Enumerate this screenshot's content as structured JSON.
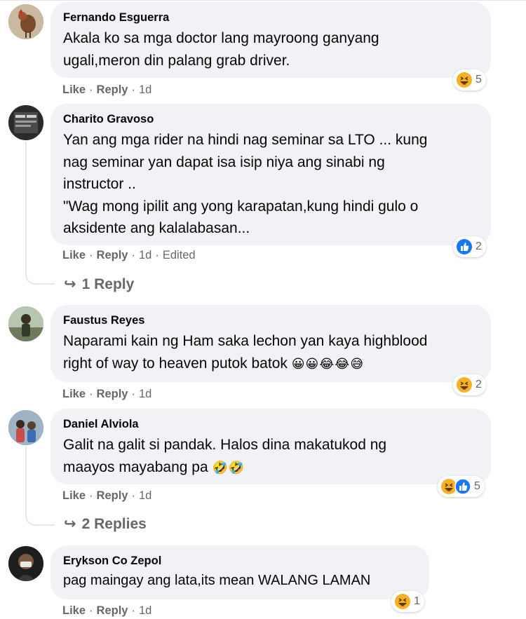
{
  "comments": [
    {
      "author": "Fernando Esguerra",
      "text": "Akala ko sa mga doctor lang mayroong ganyang\nugali,meron din palang grab driver.",
      "emoji": "",
      "like": "Like",
      "reply": "Reply",
      "time": "1d",
      "edited": "",
      "reactions": [
        "haha"
      ],
      "reaction_count": "5",
      "replies_label": ""
    },
    {
      "author": "Charito Gravoso",
      "text": "Yan ang mga rider na hindi nag seminar sa LTO ... kung\nnag seminar yan dapat isa isip niya ang sinabi ng\ninstructor ..\n\"Wag mong ipilit ang yong karapatan,kung hindi gulo o\naksidente ang kalalabasan...",
      "emoji": "",
      "like": "Like",
      "reply": "Reply",
      "time": "1d",
      "edited": "Edited",
      "reactions": [
        "like"
      ],
      "reaction_count": "2",
      "replies_label": "1 Reply"
    },
    {
      "author": "Faustus Reyes",
      "text": "Naparami kain ng Ham saka lechon yan kaya highblood\nright of way to heaven putok batok ",
      "emoji": "😀😀😂😂😅",
      "like": "Like",
      "reply": "Reply",
      "time": "1d",
      "edited": "",
      "reactions": [
        "haha"
      ],
      "reaction_count": "2",
      "replies_label": ""
    },
    {
      "author": "Daniel Alviola",
      "text": "Galit na galit si pandak. Halos dina makatukod ng\nmaayos mayabang pa ",
      "emoji": "🤣🤣",
      "like": "Like",
      "reply": "Reply",
      "time": "1d",
      "edited": "",
      "reactions": [
        "haha",
        "like"
      ],
      "reaction_count": "5",
      "replies_label": "2 Replies"
    },
    {
      "author": "Erykson Co Zepol",
      "text": "pag maingay ang lata,its mean WALANG LAMAN",
      "emoji": "",
      "like": "Like",
      "reply": "Reply",
      "time": "1d",
      "edited": "",
      "reactions": [
        "haha"
      ],
      "reaction_count": "1",
      "replies_label": ""
    }
  ],
  "dot": "·",
  "reply_arrow": "↪",
  "colors": {
    "bubble": "#f0f2f5",
    "secondary_text": "#65676b",
    "like_blue": "#1877f2",
    "haha_yellow": "#f7b125"
  }
}
